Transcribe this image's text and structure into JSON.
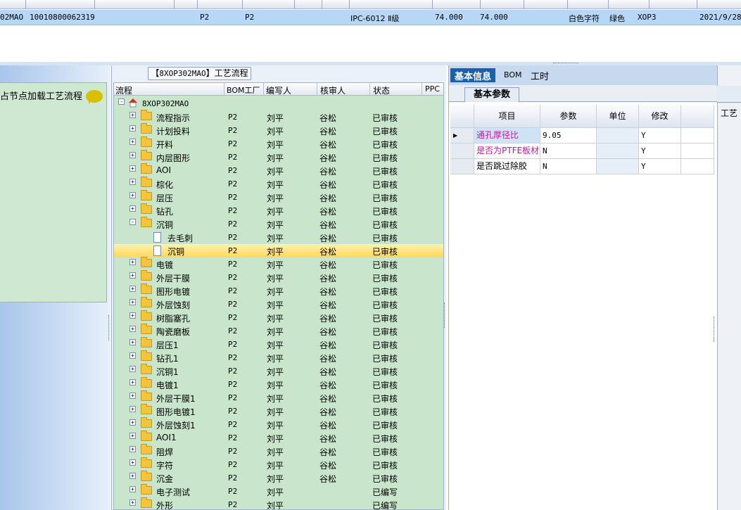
{
  "top_table": {
    "row": {
      "code": "02MAO",
      "serial": "10010800062319",
      "col_a": "P2",
      "col_b": "P2",
      "material": "IPC-6012 Ⅱ级",
      "thickness": "74.000",
      "thickness2": "74.000",
      "char_color": "白色字符",
      "mask_color": "绿色",
      "mark": "XOP3",
      "date": "2021/9/28"
    }
  },
  "left_panel": {
    "title": "占节点加载工艺流程"
  },
  "middle_panel": {
    "tab_code": "8XOP302MAO",
    "tab_title": "工艺流程",
    "columns": [
      "流程",
      "BOM工厂",
      "编写人",
      "核审人",
      "状态",
      "PPC"
    ],
    "root": "8XOP302MAO",
    "rows": [
      {
        "name": "流程指示",
        "bom": "P2",
        "writer": "刘平",
        "checker": "谷松",
        "status": "已审核",
        "level": 1,
        "expander": "+"
      },
      {
        "name": "计划投料",
        "bom": "P2",
        "writer": "刘平",
        "checker": "谷松",
        "status": "已审核",
        "level": 1,
        "expander": "+"
      },
      {
        "name": "开料",
        "bom": "P2",
        "writer": "刘平",
        "checker": "谷松",
        "status": "已审核",
        "level": 1,
        "expander": "+"
      },
      {
        "name": "内层图形",
        "bom": "P2",
        "writer": "刘平",
        "checker": "谷松",
        "status": "已审核",
        "level": 1,
        "expander": "+"
      },
      {
        "name": "AOI",
        "bom": "P2",
        "writer": "刘平",
        "checker": "谷松",
        "status": "已审核",
        "level": 1,
        "expander": "+"
      },
      {
        "name": "棕化",
        "bom": "P2",
        "writer": "刘平",
        "checker": "谷松",
        "status": "已审核",
        "level": 1,
        "expander": "+"
      },
      {
        "name": "层压",
        "bom": "P2",
        "writer": "刘平",
        "checker": "谷松",
        "status": "已审核",
        "level": 1,
        "expander": "+"
      },
      {
        "name": "钻孔",
        "bom": "P2",
        "writer": "刘平",
        "checker": "谷松",
        "status": "已审核",
        "level": 1,
        "expander": "+"
      },
      {
        "name": "沉铜",
        "bom": "P2",
        "writer": "刘平",
        "checker": "谷松",
        "status": "已审核",
        "level": 1,
        "expander": "-"
      },
      {
        "name": "去毛刺",
        "bom": "P2",
        "writer": "刘平",
        "checker": "谷松",
        "status": "已审核",
        "level": 2,
        "expander": ""
      },
      {
        "name": "沉铜",
        "bom": "P2",
        "writer": "刘平",
        "checker": "谷松",
        "status": "已审核",
        "level": 2,
        "expander": "",
        "selected": true
      },
      {
        "name": "电镀",
        "bom": "P2",
        "writer": "刘平",
        "checker": "谷松",
        "status": "已审核",
        "level": 1,
        "expander": "+"
      },
      {
        "name": "外层干膜",
        "bom": "P2",
        "writer": "刘平",
        "checker": "谷松",
        "status": "已审核",
        "level": 1,
        "expander": "+"
      },
      {
        "name": "图形电镀",
        "bom": "P2",
        "writer": "刘平",
        "checker": "谷松",
        "status": "已审核",
        "level": 1,
        "expander": "+"
      },
      {
        "name": "外层蚀刻",
        "bom": "P2",
        "writer": "刘平",
        "checker": "谷松",
        "status": "已审核",
        "level": 1,
        "expander": "+"
      },
      {
        "name": "树脂塞孔",
        "bom": "P2",
        "writer": "刘平",
        "checker": "谷松",
        "status": "已审核",
        "level": 1,
        "expander": "+"
      },
      {
        "name": "陶瓷磨板",
        "bom": "P2",
        "writer": "刘平",
        "checker": "谷松",
        "status": "已审核",
        "level": 1,
        "expander": "+"
      },
      {
        "name": "层压1",
        "bom": "P2",
        "writer": "刘平",
        "checker": "谷松",
        "status": "已审核",
        "level": 1,
        "expander": "+"
      },
      {
        "name": "钻孔1",
        "bom": "P2",
        "writer": "刘平",
        "checker": "谷松",
        "status": "已审核",
        "level": 1,
        "expander": "+"
      },
      {
        "name": "沉铜1",
        "bom": "P2",
        "writer": "刘平",
        "checker": "谷松",
        "status": "已审核",
        "level": 1,
        "expander": "+"
      },
      {
        "name": "电镀1",
        "bom": "P2",
        "writer": "刘平",
        "checker": "谷松",
        "status": "已审核",
        "level": 1,
        "expander": "+"
      },
      {
        "name": "外层干膜1",
        "bom": "P2",
        "writer": "刘平",
        "checker": "谷松",
        "status": "已审核",
        "level": 1,
        "expander": "+"
      },
      {
        "name": "图形电镀1",
        "bom": "P2",
        "writer": "刘平",
        "checker": "谷松",
        "status": "已审核",
        "level": 1,
        "expander": "+"
      },
      {
        "name": "外层蚀刻1",
        "bom": "P2",
        "writer": "刘平",
        "checker": "谷松",
        "status": "已审核",
        "level": 1,
        "expander": "+"
      },
      {
        "name": "AOI1",
        "bom": "P2",
        "writer": "刘平",
        "checker": "谷松",
        "status": "已审核",
        "level": 1,
        "expander": "+"
      },
      {
        "name": "阻焊",
        "bom": "P2",
        "writer": "刘平",
        "checker": "谷松",
        "status": "已审核",
        "level": 1,
        "expander": "+"
      },
      {
        "name": "字符",
        "bom": "P2",
        "writer": "刘平",
        "checker": "谷松",
        "status": "已审核",
        "level": 1,
        "expander": "+"
      },
      {
        "name": "沉金",
        "bom": "P2",
        "writer": "刘平",
        "checker": "谷松",
        "status": "已审核",
        "level": 1,
        "expander": "+"
      },
      {
        "name": "电子测试",
        "bom": "P2",
        "writer": "刘平",
        "checker": "",
        "status": "已编写",
        "level": 1,
        "expander": "+"
      },
      {
        "name": "外形",
        "bom": "P2",
        "writer": "刘平",
        "checker": "",
        "status": "已编写",
        "level": 1,
        "expander": "+"
      }
    ]
  },
  "right_panel": {
    "tabs": [
      {
        "label": "基本信息",
        "active": true
      },
      {
        "label": "BOM",
        "active": false
      },
      {
        "label": "工时",
        "active": false
      }
    ],
    "subtab": "基本参数",
    "params_columns": [
      "项目",
      "参数",
      "单位",
      "修改"
    ],
    "params": [
      {
        "item": "通孔厚径比",
        "value": "9.05",
        "unit": "",
        "modify": "Y",
        "item_color": "#c0189a"
      },
      {
        "item": "是否为PTFE板材",
        "value": "N",
        "unit": "",
        "modify": "Y",
        "item_color": "#c0189a"
      },
      {
        "item": "是否跳过除胶",
        "value": "N",
        "unit": "",
        "modify": "Y",
        "item_color": "#000000"
      }
    ]
  },
  "far_right": {
    "label": "工艺"
  }
}
